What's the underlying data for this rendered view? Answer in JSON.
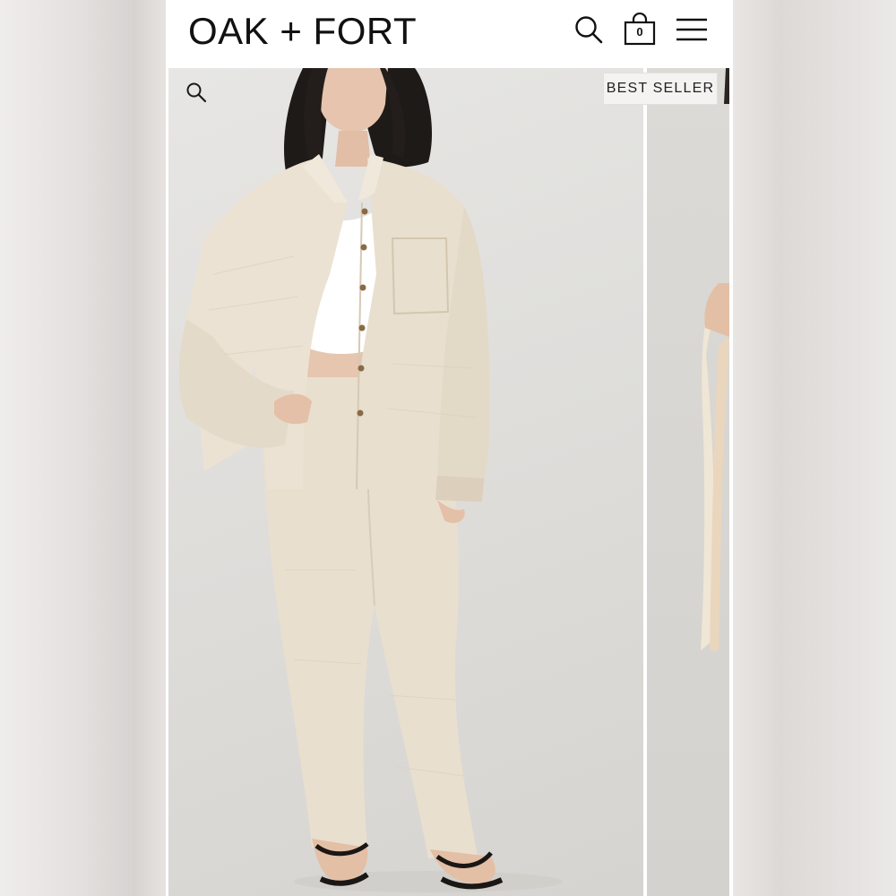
{
  "brand": {
    "logo_text": "OAK + FORT"
  },
  "header": {
    "search_icon": "search-icon",
    "bag_icon": "shopping-bag-icon",
    "bag_count": "0",
    "menu_icon": "hamburger-menu-icon"
  },
  "product_gallery": {
    "badge": "BEST SELLER",
    "zoom_icon": "magnifier-icon",
    "current_image": "Model wearing cream textured button-up shirt over white tank with matching cream wide-leg pants and black sandals",
    "next_image": "Partial view of model in cream shirt"
  },
  "colors": {
    "background_gray": "#e3e0de",
    "garment_cream": "#e9dfcf",
    "text_dark": "#111111",
    "badge_bg": "#f4f3f2"
  }
}
